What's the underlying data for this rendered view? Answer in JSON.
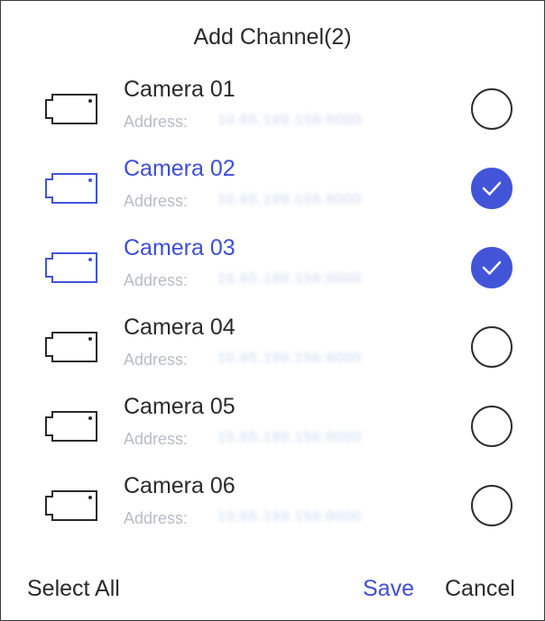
{
  "dialog": {
    "title": "Add Channel(2)"
  },
  "cameras": [
    {
      "name": "Camera 01",
      "address_label": "Address:",
      "address": "10.65.199.156:8000",
      "selected": false
    },
    {
      "name": "Camera 02",
      "address_label": "Address:",
      "address": "10.65.199.156:8000",
      "selected": true
    },
    {
      "name": "Camera 03",
      "address_label": "Address:",
      "address": "10.65.199.156:8000",
      "selected": true
    },
    {
      "name": "Camera 04",
      "address_label": "Address:",
      "address": "10.65.199.156:8000",
      "selected": false
    },
    {
      "name": "Camera 05",
      "address_label": "Address:",
      "address": "10.65.199.156:8000",
      "selected": false
    },
    {
      "name": "Camera 06",
      "address_label": "Address:",
      "address": "10.65.199.156:8000",
      "selected": false
    }
  ],
  "footer": {
    "select_all": "Select All",
    "save": "Save",
    "cancel": "Cancel"
  },
  "colors": {
    "accent": "#4254d8",
    "text": "#2a2a2a",
    "muted": "#b9bcc6"
  },
  "icons": {
    "camera": "video-camera-icon",
    "checkbox": "circle-checkbox-icon",
    "check": "checkmark-icon"
  }
}
